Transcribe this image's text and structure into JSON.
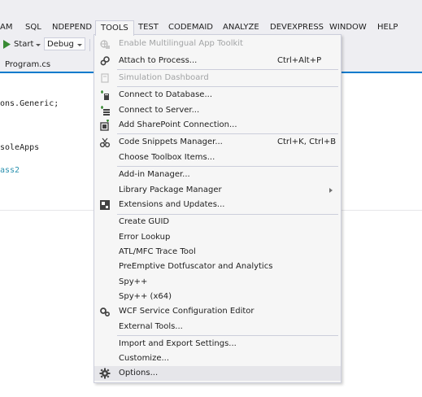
{
  "menubar": {
    "items": [
      "AM",
      "SQL",
      "NDEPEND",
      "TOOLS",
      "TEST",
      "CODEMAID",
      "ANALYZE",
      "DEVEXPRESS",
      "WINDOW",
      "HELP"
    ],
    "active": "TOOLS"
  },
  "toolbar": {
    "start_label": "Start",
    "config_value": "Debug"
  },
  "tab": {
    "label": "Program.cs"
  },
  "editor": {
    "lines": [
      "ons.Generic;",
      "soleApps",
      "ass2"
    ]
  },
  "tools_menu": {
    "items": [
      {
        "label": "Enable Multilingual App Toolkit",
        "shortcut": "",
        "disabled": true,
        "icon": "globe-icon"
      },
      {
        "label": "Attach to Process...",
        "shortcut": "Ctrl+Alt+P",
        "disabled": false,
        "icon": "attach-gears-icon"
      },
      {
        "label": "Simulation Dashboard",
        "shortcut": "",
        "disabled": true,
        "icon": "dashboard-icon"
      },
      {
        "label": "Connect to Database...",
        "shortcut": "",
        "disabled": false,
        "icon": "database-plug-icon"
      },
      {
        "label": "Connect to Server...",
        "shortcut": "",
        "disabled": false,
        "icon": "server-plug-icon"
      },
      {
        "label": "Add SharePoint Connection...",
        "shortcut": "",
        "disabled": false,
        "icon": "sharepoint-icon"
      },
      {
        "label": "Code Snippets Manager...",
        "shortcut": "Ctrl+K, Ctrl+B",
        "disabled": false,
        "icon": "snippets-icon"
      },
      {
        "label": "Choose Toolbox Items...",
        "shortcut": "",
        "disabled": false,
        "icon": ""
      },
      {
        "label": "Add-in Manager...",
        "shortcut": "",
        "disabled": false,
        "icon": ""
      },
      {
        "label": "Library Package Manager",
        "shortcut": "",
        "disabled": false,
        "icon": "",
        "submenu": true
      },
      {
        "label": "Extensions and Updates...",
        "shortcut": "",
        "disabled": false,
        "icon": "extensions-icon"
      },
      {
        "label": "Create GUID",
        "shortcut": "",
        "disabled": false,
        "icon": ""
      },
      {
        "label": "Error Lookup",
        "shortcut": "",
        "disabled": false,
        "icon": ""
      },
      {
        "label": "ATL/MFC Trace Tool",
        "shortcut": "",
        "disabled": false,
        "icon": ""
      },
      {
        "label": "PreEmptive Dotfuscator and Analytics",
        "shortcut": "",
        "disabled": false,
        "icon": ""
      },
      {
        "label": "Spy++",
        "shortcut": "",
        "disabled": false,
        "icon": ""
      },
      {
        "label": "Spy++ (x64)",
        "shortcut": "",
        "disabled": false,
        "icon": ""
      },
      {
        "label": "WCF Service Configuration Editor",
        "shortcut": "",
        "disabled": false,
        "icon": "wcf-gears-icon"
      },
      {
        "label": "External Tools...",
        "shortcut": "",
        "disabled": false,
        "icon": ""
      },
      {
        "label": "Import and Export Settings...",
        "shortcut": "",
        "disabled": false,
        "icon": ""
      },
      {
        "label": "Customize...",
        "shortcut": "",
        "disabled": false,
        "icon": ""
      },
      {
        "label": "Options...",
        "shortcut": "",
        "disabled": false,
        "icon": "options-gear-icon",
        "hover": true
      }
    ]
  },
  "colors": {
    "menubar_bg": "#eeeef2",
    "accent": "#007acc",
    "disabled_text": "#a2a4a5",
    "play_green": "#388a34"
  }
}
